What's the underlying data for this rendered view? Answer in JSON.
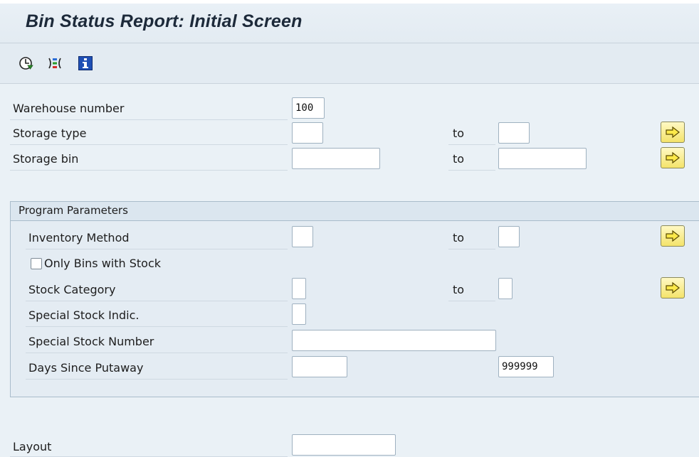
{
  "window": {
    "title": "Bin Status Report: Initial Screen"
  },
  "toolbar": {
    "icons": [
      "execute-icon",
      "selection-options-icon",
      "info-icon"
    ]
  },
  "fields": {
    "warehouse_number": {
      "label": "Warehouse number",
      "value": "100"
    },
    "storage_type": {
      "label": "Storage type",
      "from": "",
      "to_label": "to",
      "to": ""
    },
    "storage_bin": {
      "label": "Storage bin",
      "from": "",
      "to_label": "to",
      "to": ""
    }
  },
  "program_parameters": {
    "title": "Program Parameters",
    "inventory_method": {
      "label": "Inventory Method",
      "from": "",
      "to_label": "to",
      "to": ""
    },
    "only_bins_with_stock": {
      "label": "Only Bins with Stock",
      "checked": false
    },
    "stock_category": {
      "label": "Stock Category",
      "from": "",
      "to_label": "to",
      "to": ""
    },
    "special_stock_indic": {
      "label": "Special Stock Indic.",
      "value": ""
    },
    "special_stock_number": {
      "label": "Special Stock Number",
      "value": ""
    },
    "days_since_putaway": {
      "label": "Days Since Putaway",
      "from": "",
      "to": "999999"
    }
  },
  "layout": {
    "label": "Layout",
    "value": ""
  },
  "colors": {
    "arrow_button": "#f4e36a",
    "background": "#eaf1f6"
  }
}
